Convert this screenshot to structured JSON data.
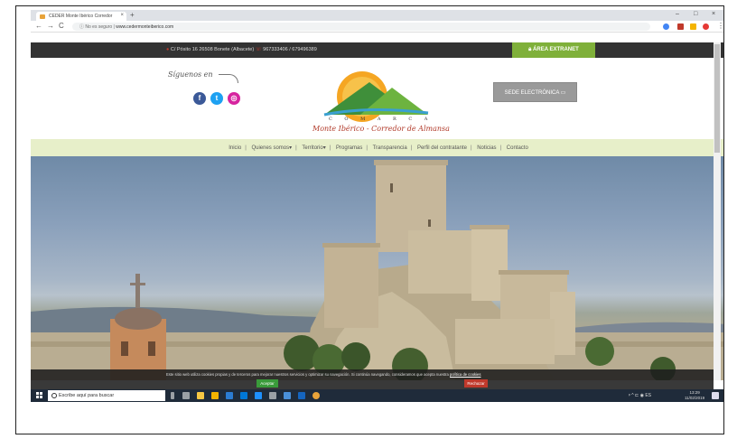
{
  "browser": {
    "tab_title": "CEDER Monte Ibérico Corredor",
    "tab_close": "×",
    "new_tab": "+",
    "window_controls": [
      "–",
      "□",
      "×"
    ],
    "nav": [
      "←",
      "→",
      "C"
    ],
    "security_label": "No es seguro",
    "url": "www.cedermonteiberico.com",
    "extension_colors": [
      "#4285f4",
      "#c0392b",
      "#f4b400",
      "#e53935"
    ]
  },
  "site": {
    "address": "C/ Pósito 16 26508 Bonete (Albacete)",
    "phone": "967333406 / 679496389",
    "extranet_label": "ÁREA EXTRANET",
    "follow_us": "Síguenos en",
    "social": [
      {
        "name": "facebook",
        "glyph": "f",
        "color": "#3b5998"
      },
      {
        "name": "twitter",
        "glyph": "t",
        "color": "#1da1f2"
      },
      {
        "name": "instagram",
        "glyph": "◎",
        "color": "#d6249f"
      }
    ],
    "logo_line1": "C O M A R C A",
    "logo_line2": "Monte Ibérico - Corredor de Almansa",
    "sede_label": "SEDE ELECTRÓNICA",
    "menu": [
      "Inicio",
      "Quienes somos",
      "Territorio",
      "Programas",
      "Transparencia",
      "Perfil del contratante",
      "Noticias",
      "Contacto"
    ],
    "menu_dropdowns": [
      "",
      "▾",
      "▾",
      "",
      "",
      "",
      "",
      ""
    ],
    "cookie_text": "Este sitio web utiliza cookies propias y de terceros para mejorar nuestros servicios y optimizar su navegación. Si continúa navegando, consideramos que acepta nuestra",
    "cookie_link": "política de cookies",
    "accept_label": "Aceptar",
    "reject_label": "Rechazar"
  },
  "taskbar": {
    "search_placeholder": "Escribe aquí para buscar",
    "tray_text": "ᵖ  ^  ⊏  ◉  ES",
    "time": "13:29",
    "date": "11/02/2019",
    "icon_colors": [
      "#9aa0a6",
      "#f6c744",
      "#f4b400",
      "#2b7cd3",
      "#0078d7",
      "#2d7d9a",
      "#1e90ff",
      "#9aa0a6",
      "#4a90d9",
      "#1565c0",
      "#e8a33a"
    ]
  }
}
